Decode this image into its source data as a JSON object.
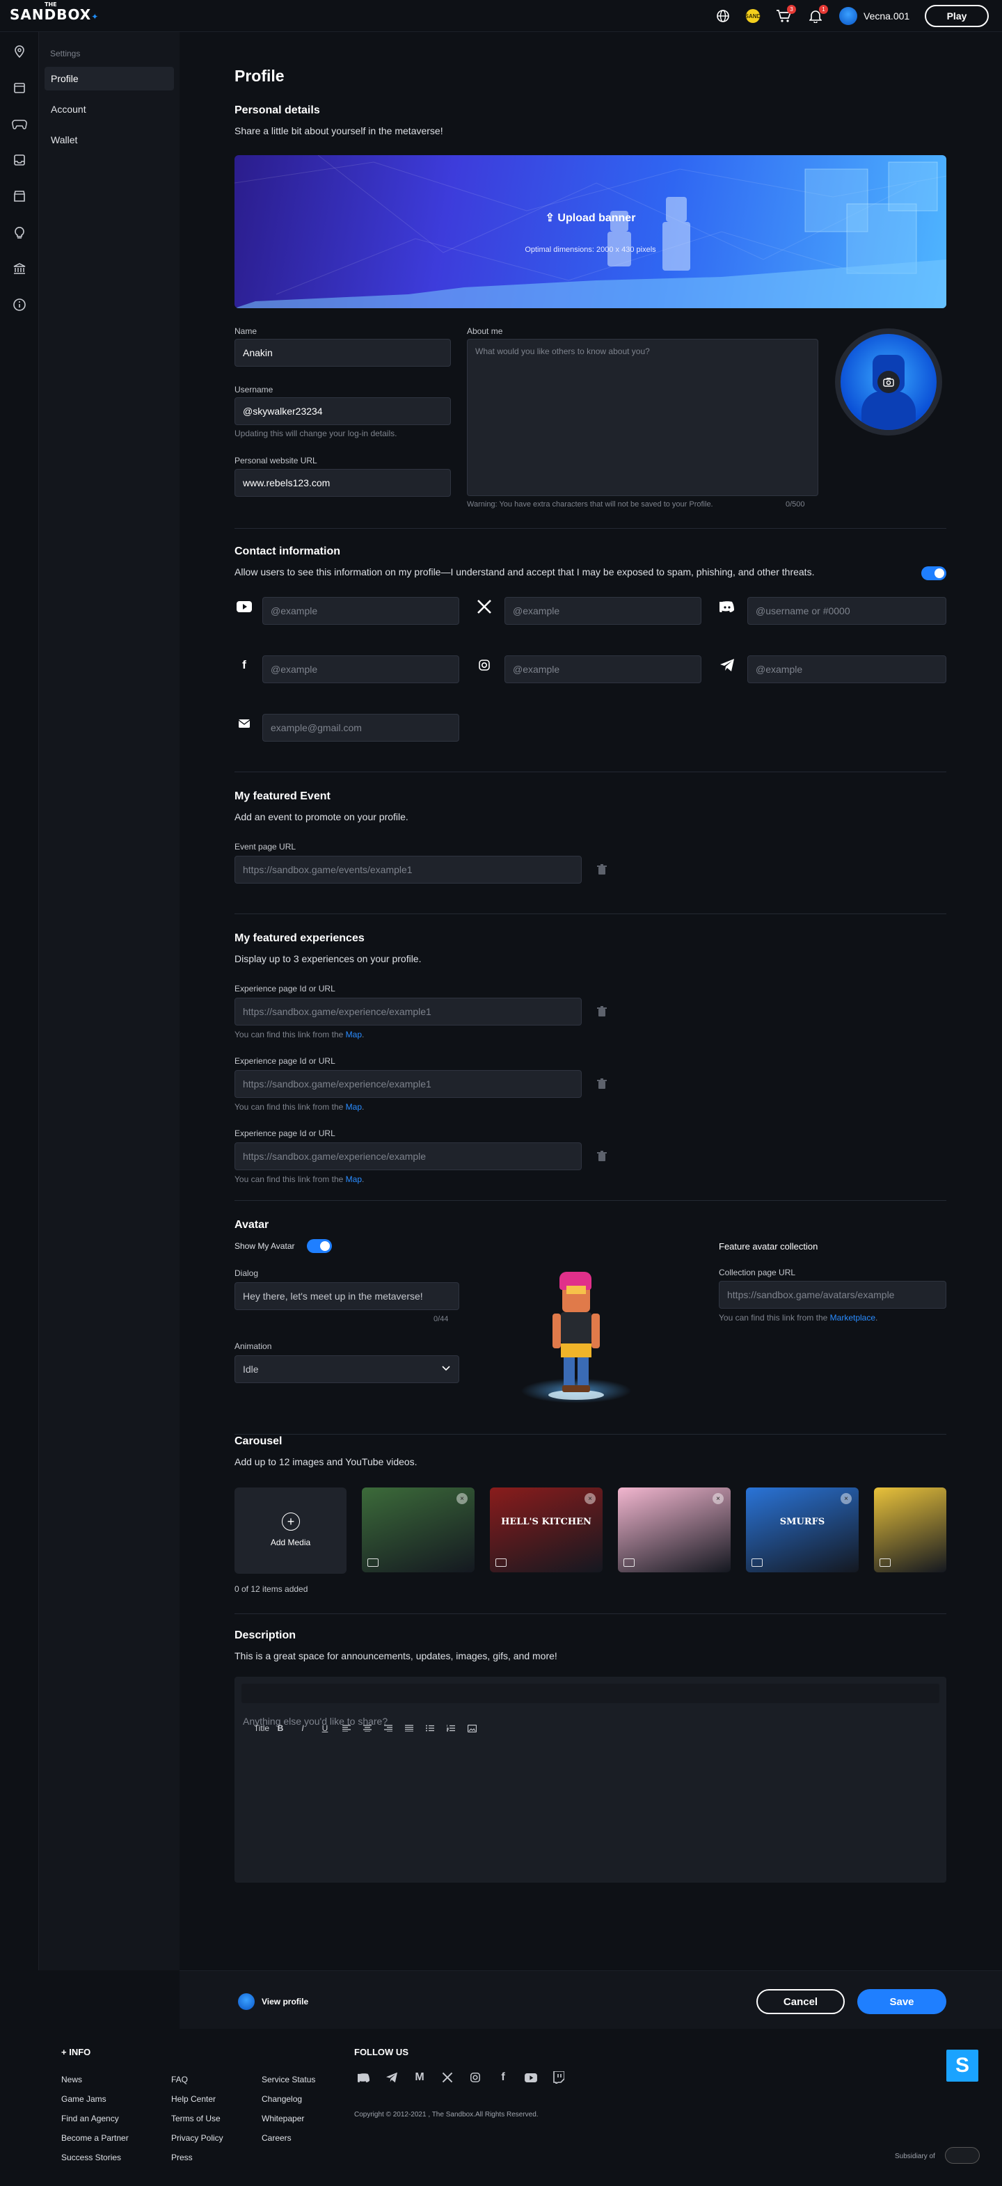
{
  "topbar": {
    "logo_the": "THE",
    "logo_text": "SANDBOX",
    "coin_label": "SAND",
    "cart_count": "3",
    "notif_count": "1",
    "username": "Vecna.001",
    "play_label": "Play"
  },
  "rail": {
    "icons": [
      "map-pin-icon",
      "calendar-icon",
      "gamepad-icon",
      "inbox-icon",
      "store-icon",
      "lightbulb-icon",
      "bank-icon",
      "info-icon"
    ]
  },
  "settings_nav": {
    "heading": "Settings",
    "items": [
      {
        "label": "Profile"
      },
      {
        "label": "Account"
      },
      {
        "label": "Wallet"
      }
    ]
  },
  "profile": {
    "title": "Profile",
    "personal": {
      "title": "Personal details",
      "desc": "Share a little bit about yourself in the metaverse!",
      "banner_upload": "Upload banner",
      "banner_hint": "Optimal dimensions: 2000 x 430 pixels",
      "name_label": "Name",
      "name_value": "Anakin",
      "username_label": "Username",
      "username_value": "@skywalker23234",
      "username_hint": "Updating this will change your log-in details.",
      "website_label": "Personal website URL",
      "website_value": "www.rebels123.com",
      "about_label": "About me",
      "about_placeholder": "What would you like others to know about you?",
      "about_warning": "Warning: You have extra characters that will not be saved to your Profile.",
      "about_count": "0/500"
    },
    "contact": {
      "title": "Contact information",
      "desc": "Allow users to see this information on my profile—I understand and accept that I may be exposed to spam, phishing, and other threats.",
      "toggle_on": true,
      "fields": {
        "youtube": "@example",
        "x": "@example",
        "discord": "@username or #0000",
        "facebook": "@example",
        "instagram": "@example",
        "telegram": "@example",
        "email": "example@gmail.com"
      }
    },
    "event": {
      "title": "My featured Event",
      "desc": "Add an event to promote on your profile.",
      "label": "Event page URL",
      "placeholder": "https://sandbox.game/events/example1"
    },
    "experiences": {
      "title": "My featured experiences",
      "desc": "Display up to 3 experiences on your profile.",
      "items": [
        {
          "label": "Experience page Id or URL",
          "placeholder": "https://sandbox.game/experience/example1",
          "hint": "You can find this link from the ",
          "hint_link": "Map",
          "hint_end": "."
        },
        {
          "label": "Experience page Id or URL",
          "placeholder": "https://sandbox.game/experience/example1",
          "hint": "You can find this link from the ",
          "hint_link": "Map",
          "hint_end": "."
        },
        {
          "label": "Experience page Id or URL",
          "placeholder": "https://sandbox.game/experience/example",
          "hint": "You can find this link from the ",
          "hint_link": "Map",
          "hint_end": "."
        }
      ]
    },
    "avatar": {
      "title": "Avatar",
      "show_label": "Show My Avatar",
      "show_on": true,
      "dialog_label": "Dialog",
      "dialog_value": "Hey there, let's meet up in the metaverse!",
      "dialog_count": "0/44",
      "animation_label": "Animation",
      "animation_value": "Idle",
      "collection_title": "Feature avatar collection",
      "collection_label": "Collection page URL",
      "collection_placeholder": "https://sandbox.game/avatars/example",
      "collection_hint": "You can find this link from the ",
      "collection_hint_link": "Marketplace",
      "collection_hint_end": "."
    },
    "carousel": {
      "title": "Carousel",
      "desc": "Add up to 12 images and YouTube videos.",
      "add_label": "Add Media",
      "count_text": "0 of 12 items added",
      "thumbs": [
        {
          "caption": "",
          "color": "#3c6b3a"
        },
        {
          "caption": "HELL'S KITCHEN",
          "color": "#8a1c1c"
        },
        {
          "caption": "",
          "color": "#f2b6cf"
        },
        {
          "caption": "SMURFS",
          "color": "#2a74d8"
        },
        {
          "caption": "",
          "color": "#e9c23b"
        }
      ]
    },
    "description": {
      "title": "Description",
      "desc": "This is a great space for announcements, updates, images, gifs, and more!",
      "toolbar_title": "Title",
      "toolbar_bold": "B",
      "toolbar_italic": "I",
      "toolbar_underline": "U",
      "placeholder": "Anything else you'd like to share?"
    }
  },
  "actions": {
    "view_profile": "View profile",
    "cancel": "Cancel",
    "save": "Save"
  },
  "footer": {
    "info_title": "+ INFO",
    "col1": [
      "News",
      "Game Jams",
      "Find an Agency",
      "Become a Partner",
      "Success Stories"
    ],
    "col2": [
      "FAQ",
      "Help Center",
      "Terms of Use",
      "Privacy Policy",
      "Press"
    ],
    "col3": [
      "Service Status",
      "Changelog",
      "Whitepaper",
      "Careers"
    ],
    "follow_title": "FOLLOW US",
    "copyright": "Copyright © 2012-2021 , The Sandbox.All Rights Reserved.",
    "subsidiary": "Subsidiary of",
    "brand_letter": "S"
  },
  "colors": {
    "accent": "#1f7fff",
    "bg": "#0e1116"
  }
}
